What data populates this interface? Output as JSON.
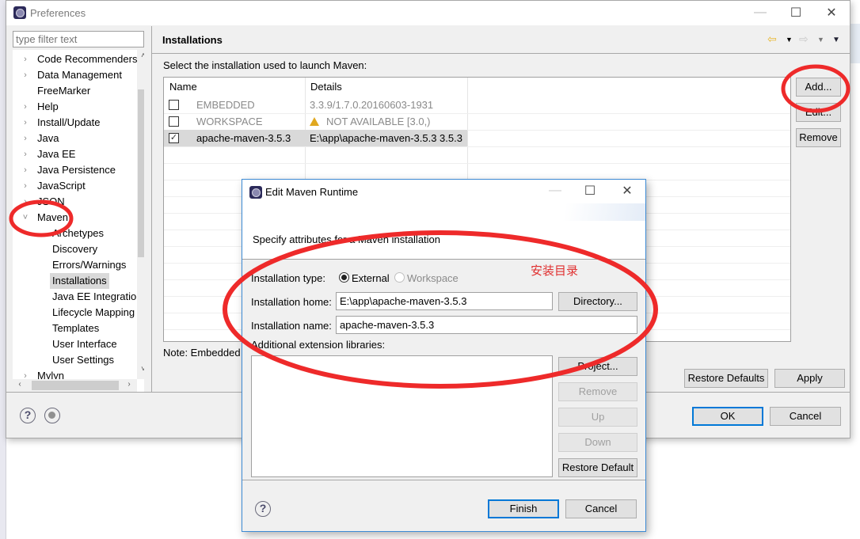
{
  "preferences": {
    "title": "Preferences",
    "filter_placeholder": "type filter text",
    "tree": [
      {
        "label": "Code Recommenders",
        "expandable": true,
        "expanded": false,
        "level": 0
      },
      {
        "label": "Data Management",
        "expandable": true,
        "expanded": false,
        "level": 0
      },
      {
        "label": "FreeMarker",
        "expandable": false,
        "level": 0
      },
      {
        "label": "Help",
        "expandable": true,
        "expanded": false,
        "level": 0
      },
      {
        "label": "Install/Update",
        "expandable": true,
        "expanded": false,
        "level": 0
      },
      {
        "label": "Java",
        "expandable": true,
        "expanded": false,
        "level": 0
      },
      {
        "label": "Java EE",
        "expandable": true,
        "expanded": false,
        "level": 0
      },
      {
        "label": "Java Persistence",
        "expandable": true,
        "expanded": false,
        "level": 0
      },
      {
        "label": "JavaScript",
        "expandable": true,
        "expanded": false,
        "level": 0
      },
      {
        "label": "JSON",
        "expandable": true,
        "expanded": false,
        "level": 0
      },
      {
        "label": "Maven",
        "expandable": true,
        "expanded": true,
        "level": 0
      },
      {
        "label": "Archetypes",
        "level": 1
      },
      {
        "label": "Discovery",
        "level": 1
      },
      {
        "label": "Errors/Warnings",
        "level": 1
      },
      {
        "label": "Installations",
        "level": 1,
        "selected": true
      },
      {
        "label": "Java EE Integration",
        "level": 1
      },
      {
        "label": "Lifecycle Mapping",
        "level": 1
      },
      {
        "label": "Templates",
        "level": 1
      },
      {
        "label": "User Interface",
        "level": 1
      },
      {
        "label": "User Settings",
        "level": 1
      },
      {
        "label": "Mylyn",
        "expandable": true,
        "expanded": false,
        "level": 0
      }
    ],
    "page": {
      "title": "Installations",
      "description": "Select the installation used to launch Maven:",
      "columns": [
        "Name",
        "Details"
      ],
      "rows": [
        {
          "checked": false,
          "name": "EMBEDDED",
          "details": "3.3.9/1.7.0.20160603-1931",
          "disabled": true,
          "warning": false
        },
        {
          "checked": false,
          "name": "WORKSPACE",
          "details": "NOT AVAILABLE [3.0,)",
          "disabled": true,
          "warning": true
        },
        {
          "checked": true,
          "name": "apache-maven-3.5.3",
          "details": "E:\\app\\apache-maven-3.5.3 3.5.3",
          "disabled": false,
          "warning": false,
          "selected": true
        }
      ],
      "buttons": {
        "add": "Add...",
        "edit": "Edit...",
        "remove": "Remove"
      },
      "note": "Note: Embedded",
      "restore_defaults": "Restore Defaults",
      "apply": "Apply"
    },
    "ok": "OK",
    "cancel": "Cancel"
  },
  "dialog": {
    "title": "Edit Maven Runtime",
    "description": "Specify attributes for a Maven installation",
    "installation_type_label": "Installation type:",
    "type_options": [
      {
        "label": "External",
        "selected": true,
        "enabled": true
      },
      {
        "label": "Workspace",
        "selected": false,
        "enabled": false
      }
    ],
    "home_label": "Installation home:",
    "home_value": "E:\\app\\apache-maven-3.5.3",
    "directory_button": "Directory...",
    "name_label": "Installation name:",
    "name_value": "apache-maven-3.5.3",
    "libraries_label": "Additional extension libraries:",
    "side_buttons": {
      "project": "Project...",
      "remove": "Remove",
      "up": "Up",
      "down": "Down",
      "restore_default": "Restore Default"
    },
    "finish": "Finish",
    "cancel": "Cancel"
  },
  "annotation": {
    "text": "安装目录",
    "color": "#e03030"
  }
}
